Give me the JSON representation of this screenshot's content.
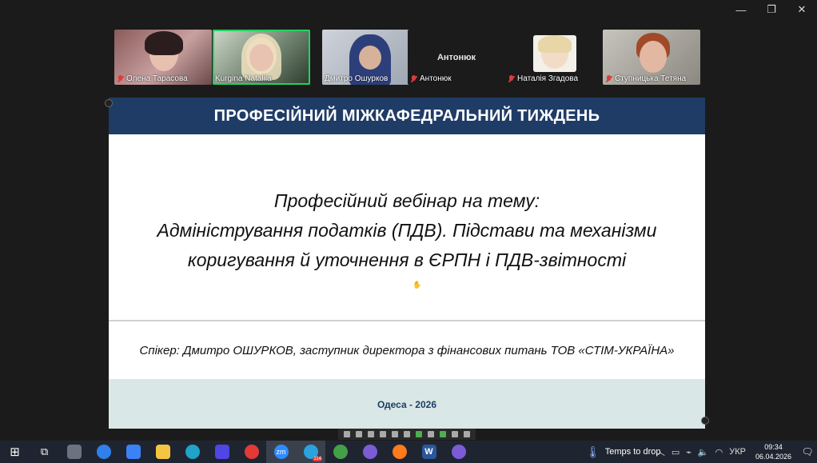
{
  "window": {
    "controls": [
      "—",
      "❐",
      "✕"
    ]
  },
  "participants": [
    {
      "name": "Олена Тарасова",
      "muted": true
    },
    {
      "name": "Kurgina Nataliia",
      "muted": false,
      "active": true
    },
    {
      "name": "Дмитро Ошурков",
      "muted": false
    },
    {
      "name": "Антонюк",
      "center_label": "Антонюк",
      "muted": true
    },
    {
      "name": "Наталія Згадова",
      "muted": true
    },
    {
      "name": "Ступницька Тетяна",
      "muted": true
    }
  ],
  "slide": {
    "header": "ПРОФЕСІЙНИЙ МІЖКАФЕДРАЛЬНИЙ ТИЖДЕНЬ",
    "body_lines": [
      "Професійний вебінар на тему:",
      "Адміністрування податків (ПДВ). Підстави та механізми",
      "коригування й уточнення в ЄРПН і ПДВ-звітності"
    ],
    "speaker": "Спікер: Дмитро ОШУРКОВ, заступник директора з фінансових питань ТОВ «СТІМ-УКРАЇНА»",
    "footer": "Одеса - 2026"
  },
  "taskbar": {
    "apps": [
      {
        "icon": "windows-start-icon",
        "label": "⊞"
      },
      {
        "icon": "task-view-icon",
        "label": "⧉"
      },
      {
        "icon": "calculator-icon",
        "color": "#6b7280"
      },
      {
        "icon": "browser-icon",
        "color": "#2f80ed"
      },
      {
        "icon": "mail-icon",
        "color": "#3b82f6"
      },
      {
        "icon": "file-explorer-icon",
        "color": "#f5c542"
      },
      {
        "icon": "edge-icon",
        "color": "#1fa3c9"
      },
      {
        "icon": "save-app-icon",
        "color": "#4f46e5"
      },
      {
        "icon": "opera-icon",
        "color": "#e53935"
      },
      {
        "icon": "zoom-icon",
        "color": "#2d8cff",
        "text": "zm",
        "active": true
      },
      {
        "icon": "telegram-icon",
        "color": "#2aa3de",
        "badge": "114",
        "active": true
      },
      {
        "icon": "utorrent-icon",
        "color": "#43a047"
      },
      {
        "icon": "viber-icon",
        "color": "#7b5cd6"
      },
      {
        "icon": "firefox-icon",
        "color": "#ff7a1a"
      },
      {
        "icon": "word-icon",
        "color": "#2b579a",
        "text": "W"
      },
      {
        "icon": "viber-icon-2",
        "color": "#7b5cd6"
      }
    ],
    "weather_text": "Temps to drop",
    "tray": {
      "language": "УКР",
      "time": "09:34",
      "date": "06.04.2026"
    }
  }
}
